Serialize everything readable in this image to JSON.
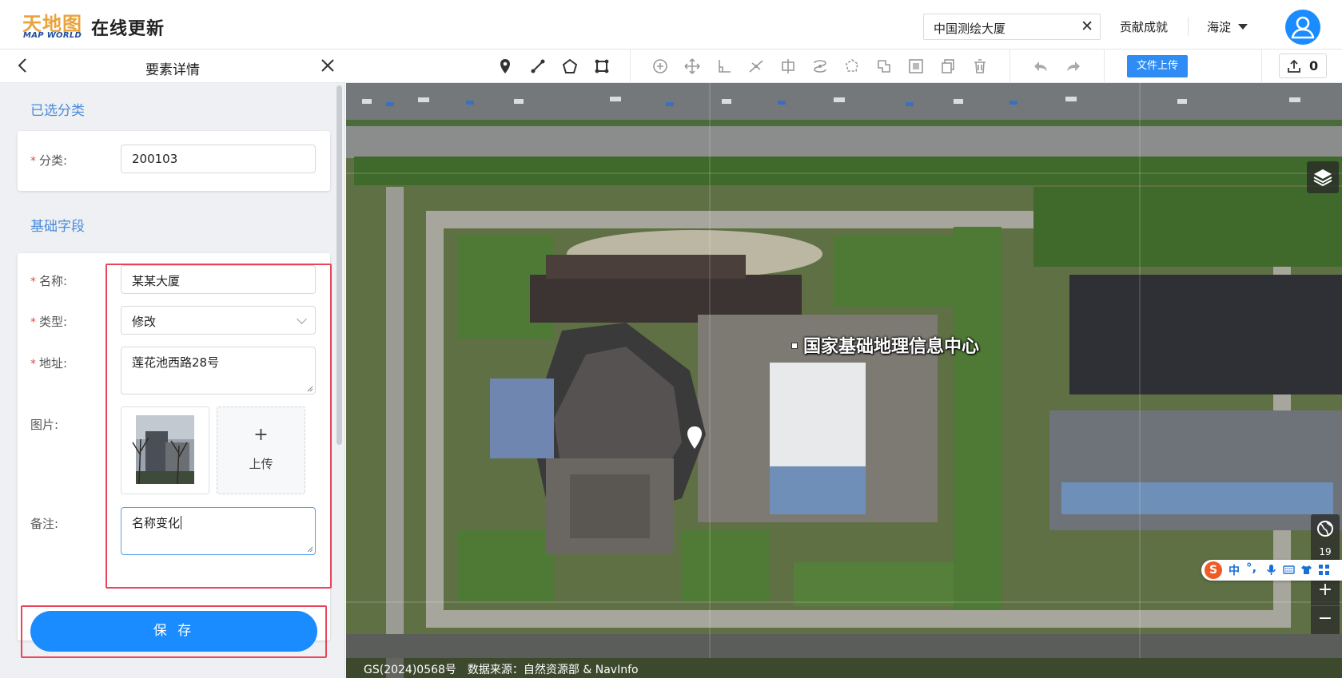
{
  "header": {
    "logo_cn": "天地图",
    "logo_en": "MAP WORLD",
    "app_title": "在线更新",
    "search_value": "中国测绘大厦",
    "contribution_link": "贡献成就",
    "region": "海淀"
  },
  "panel": {
    "title": "要素详情",
    "section_category": "已选分类",
    "category_label": "分类:",
    "category_value": "200103",
    "section_basic": "基础字段",
    "name_label": "名称:",
    "name_value": "某某大厦",
    "type_label": "类型:",
    "type_value": "修改",
    "address_label": "地址:",
    "address_value": "莲花池西路28号",
    "photo_label": "图片:",
    "upload_plus": "+",
    "upload_label": "上传",
    "remark_label": "备注:",
    "remark_value": "名称变化",
    "required_mark": "*",
    "save_button": "保 存"
  },
  "toolbar": {
    "draw_tools": [
      "marker-icon",
      "line-icon",
      "polygon-icon",
      "rectangle-icon"
    ],
    "edit_tools": [
      "add-vertex-icon",
      "move-icon",
      "angle-icon",
      "split-line-icon",
      "split-polygon-icon",
      "reshape-icon",
      "rotate-icon",
      "union-icon",
      "buffer-icon",
      "copy-icon",
      "delete-icon"
    ],
    "history_tools": [
      "undo-icon",
      "redo-icon"
    ],
    "file_upload_label": "文件上传",
    "upload_count": "0"
  },
  "map": {
    "place_label": "国家基础地理信息中心",
    "zoom_level": "19",
    "zoom_in": "+",
    "zoom_out": "−",
    "attribution": "GS(2024)0568号　数据来源：自然资源部 & NavInfo"
  },
  "ime": {
    "logo": "S",
    "mode": "中",
    "punct": "°,"
  },
  "colors": {
    "accent": "#1a8cff",
    "section_title": "#4a8bd8",
    "required": "#e24a4a",
    "highlight_box": "#e8455a"
  }
}
